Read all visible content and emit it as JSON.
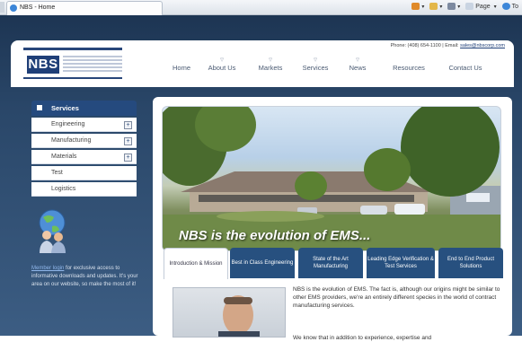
{
  "browser": {
    "tab_title": "NBS - Home",
    "tools": [
      "Page",
      "To"
    ]
  },
  "header": {
    "logo_text": "NBS",
    "phone": "Phone: (408) 654-1100",
    "email_label": "Email:",
    "email": "sales@nbscorp.com",
    "nav": [
      "Home",
      "About Us",
      "Markets",
      "Services",
      "News",
      "Resources",
      "Contact Us"
    ]
  },
  "sidebar": {
    "heading": "Services",
    "items": [
      {
        "label": "Engineering",
        "expandable": true
      },
      {
        "label": "Manufacturing",
        "expandable": true
      },
      {
        "label": "Materials",
        "expandable": true
      },
      {
        "label": "Test",
        "expandable": false
      },
      {
        "label": "Logistics",
        "expandable": false
      }
    ],
    "member_link": "Member login",
    "member_text": " for exclusive access to informative downloads and updates. It's your area on our website, so make the most of it!"
  },
  "hero": {
    "caption": "NBS is the evolution of EMS..."
  },
  "tabs": [
    {
      "label": "Introduction & Mission",
      "active": true
    },
    {
      "label": "Best in Class Engineering",
      "active": false
    },
    {
      "label": "State of the Art Manufacturing",
      "active": false
    },
    {
      "label": "Leading Edge Verification & Test Services",
      "active": false
    },
    {
      "label": "End to End Product Solutions",
      "active": false
    }
  ],
  "content": {
    "paragraph1": "NBS is the evolution of EMS. The fact is, although our origins might be similar to other EMS providers, we're an entirely different species in the world of contract manufacturing services.",
    "paragraph2": "We know that in addition to experience, expertise and"
  },
  "colors": {
    "brand_navy": "#1f3f78",
    "page_background": "#2a4769",
    "tab_blue": "#27507f"
  }
}
